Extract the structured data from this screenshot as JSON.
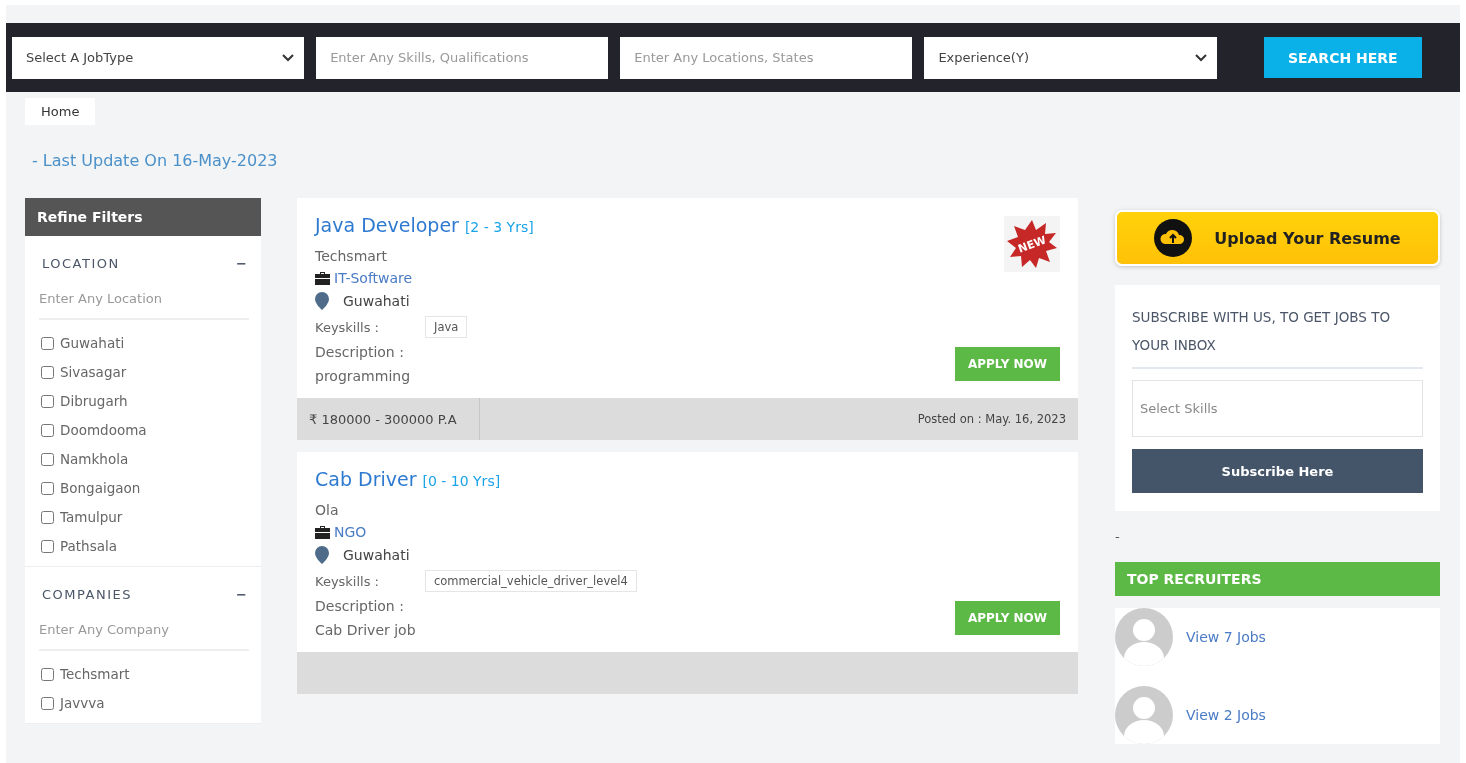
{
  "search_bar": {
    "job_type": {
      "value": "Select A JobType"
    },
    "skills": {
      "placeholder": "Enter Any Skills, Qualifications"
    },
    "locations": {
      "placeholder": "Enter Any Locations, States"
    },
    "experience": {
      "value": "Experience(Y)"
    },
    "button": "SEARCH HERE"
  },
  "breadcrumb": "Home",
  "last_update": "- Last Update On 16-May-2023",
  "filters": {
    "title": "Refine Filters",
    "sections": [
      {
        "title": "LOCATION",
        "toggle": "−",
        "expanded": true,
        "placeholder": "Enter Any Location",
        "options": [
          {
            "label": "Guwahati",
            "checked": false
          },
          {
            "label": "Sivasagar",
            "checked": false
          },
          {
            "label": "Dibrugarh",
            "checked": false
          },
          {
            "label": "Doomdooma",
            "checked": false
          },
          {
            "label": "Namkhola",
            "checked": false
          },
          {
            "label": "Bongaigaon",
            "checked": false
          },
          {
            "label": "Tamulpur",
            "checked": false
          },
          {
            "label": "Pathsala",
            "checked": false
          }
        ]
      },
      {
        "title": "COMPANIES",
        "toggle": "−",
        "expanded": true,
        "placeholder": "Enter Any Company",
        "options": [
          {
            "label": "Techsmart",
            "checked": false
          },
          {
            "label": "Javvva",
            "checked": false
          }
        ]
      }
    ]
  },
  "jobs": [
    {
      "title": "Java Developer",
      "experience": "[2 - 3 Yrs]",
      "is_new": true,
      "new_badge": "NEW",
      "company": "Techsmart",
      "category": "IT-Software",
      "location": "Guwahati",
      "keyskills_label": "Keyskills :",
      "keyskills": [
        "Java"
      ],
      "description_label": "Description :",
      "description": "programming",
      "apply": "APPLY NOW",
      "salary": "₹ 180000 - 300000 P.A",
      "posted": "Posted on : May. 16, 2023"
    },
    {
      "title": "Cab Driver",
      "experience": "[0 - 10 Yrs]",
      "is_new": false,
      "company": "Ola",
      "category": "NGO",
      "location": "Guwahati",
      "keyskills_label": "Keyskills :",
      "keyskills": [
        "commercial_vehicle_driver_level4"
      ],
      "description_label": "Description :",
      "description": "Cab Driver job",
      "apply": "APPLY NOW"
    }
  ],
  "upload_resume": "Upload Your Resume",
  "subscribe": {
    "title": "SUBSCRIBE WITH US, TO GET JOBS TO YOUR INBOX",
    "placeholder": "Select Skills",
    "button": "Subscribe Here"
  },
  "separator_text": "-",
  "top_recruiters": {
    "title": "TOP RECRUITERS",
    "items": [
      {
        "link": "View 7 Jobs"
      },
      {
        "link": "View 2 Jobs"
      }
    ]
  }
}
